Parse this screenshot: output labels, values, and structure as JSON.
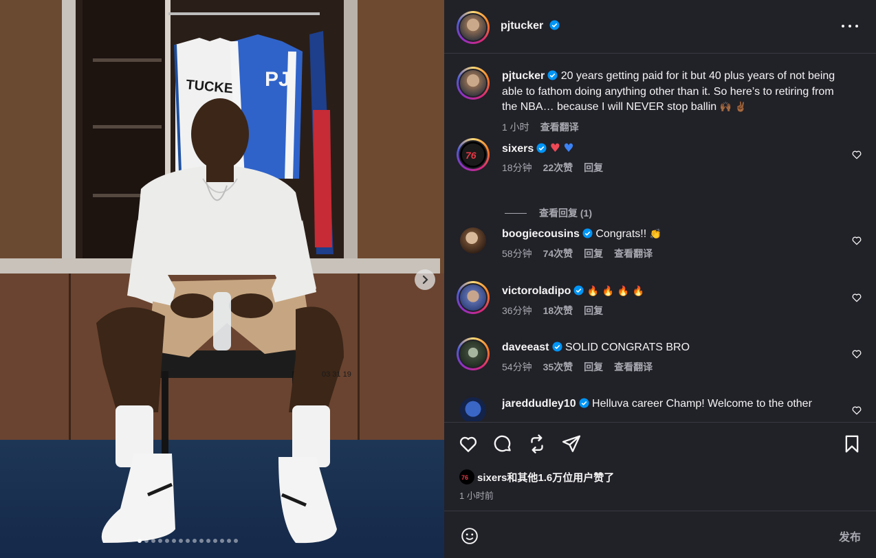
{
  "post": {
    "author": "pjtucker",
    "caption": "20 years getting paid for it but 40 plus years of not being able to fathom doing anything other than it. So here’s to retiring from the NBA… because I will NEVER stop ballin",
    "caption_emoji": "🙌🏾 ✌🏾",
    "caption_time": "1 小时",
    "translate_label": "查看翻译",
    "jersey_name": "TUCKER",
    "jacket_letters": "PJ",
    "tattoo_numbers": "03 31 19"
  },
  "comments": [
    {
      "user": "sixers",
      "text": "",
      "emoji": "❤️ 💙",
      "time": "18分钟",
      "likes": "22次赞",
      "reply": "回复",
      "translate": ""
    },
    {
      "user": "boogiecousins",
      "text": "Congrats!!",
      "emoji": "👏",
      "time": "58分钟",
      "likes": "74次赞",
      "reply": "回复",
      "translate": "查看翻译"
    },
    {
      "user": "victoroladipo",
      "text": "",
      "emoji": "🔥 🔥 🔥 🔥",
      "time": "36分钟",
      "likes": "18次赞",
      "reply": "回复",
      "translate": ""
    },
    {
      "user": "daveeast",
      "text": "SOLID CONGRATS BRO",
      "emoji": "",
      "time": "54分钟",
      "likes": "35次赞",
      "reply": "回复",
      "translate": "查看翻译"
    },
    {
      "user": "jareddudley10",
      "text": "Helluva career Champ! Welcome to the other",
      "emoji": "",
      "time": "",
      "likes": "",
      "reply": "",
      "translate": ""
    }
  ],
  "view_replies": "查看回复 (1)",
  "likes_text": "sixers和其他1.6万位用户赞了",
  "post_time": "1 小时前",
  "composer": {
    "placeholder": "",
    "post_label": "发布"
  },
  "carousel": {
    "count": 15,
    "active": 0
  },
  "colors": {
    "panel_bg": "#212128",
    "verified": "#0095f6",
    "heart_red": "#ed4956",
    "heart_blue": "#3b82f6"
  },
  "icons": [
    "verified-icon",
    "more-icon",
    "heart-icon",
    "comment-icon",
    "repost-icon",
    "share-icon",
    "bookmark-icon",
    "emoji-icon",
    "next-arrow-icon"
  ]
}
